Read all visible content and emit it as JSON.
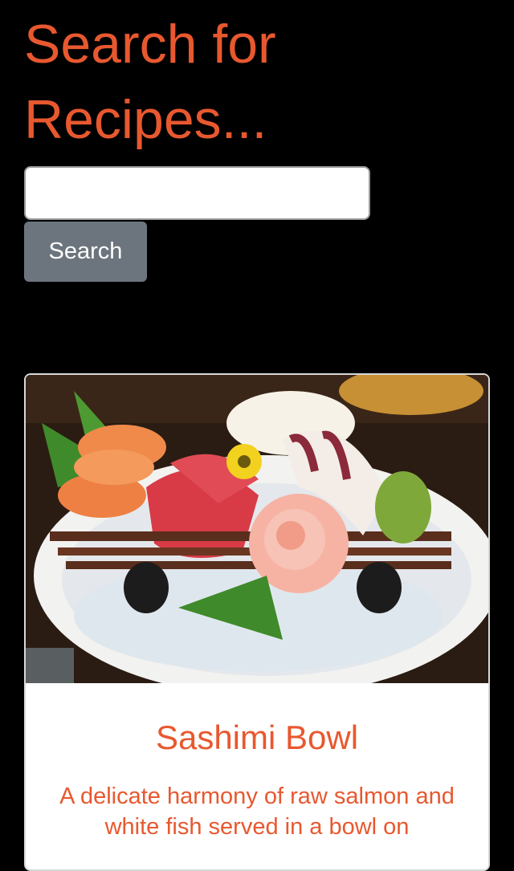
{
  "header": {
    "title": "Search for Recipes..."
  },
  "search": {
    "input_value": "",
    "placeholder": "",
    "button_label": "Search"
  },
  "recipes": [
    {
      "title": "Sashimi Bowl",
      "description": "A delicate harmony of raw salmon and white fish served in a bowl on"
    }
  ],
  "colors": {
    "accent": "#e8582f",
    "background": "#000000",
    "button": "#6c757d"
  }
}
